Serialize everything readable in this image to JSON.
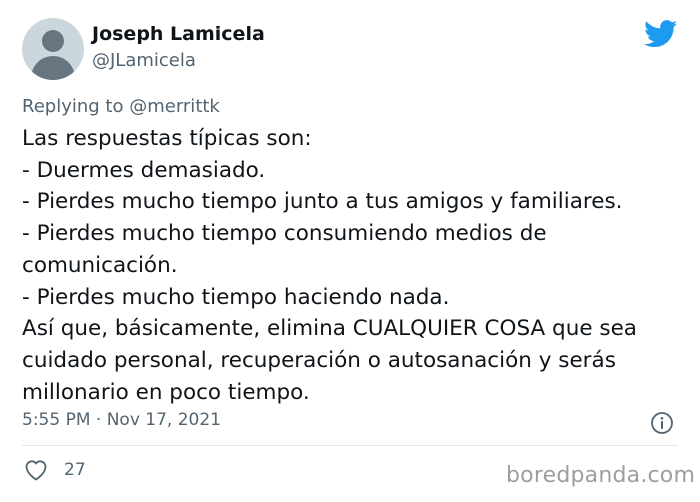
{
  "author": {
    "name": "Joseph Lamicela",
    "handle": "@JLamicela"
  },
  "reply": {
    "prefix": "Replying to",
    "mention": "@merrittk"
  },
  "tweet_lines": [
    "Las respuestas típicas son:",
    "- Duermes demasiado.",
    "- Pierdes mucho tiempo junto a tus amigos y familiares.",
    "- Pierdes mucho tiempo consumiendo medios de",
    "comunicación.",
    "- Pierdes mucho tiempo haciendo nada.",
    "Así que, básicamente, elimina CUALQUIER COSA que sea",
    "cuidado personal, recuperación o autosanación y serás",
    "millonario en poco tiempo."
  ],
  "meta": {
    "timestamp": "5:55 PM · Nov 17, 2021"
  },
  "actions": {
    "likes": "27"
  },
  "watermark": "boredpanda.com",
  "colors": {
    "twitter_blue": "#1d9bf0",
    "secondary_text": "#536471"
  },
  "icons": [
    "default-avatar-icon",
    "twitter-bird-icon",
    "info-icon",
    "heart-icon"
  ]
}
